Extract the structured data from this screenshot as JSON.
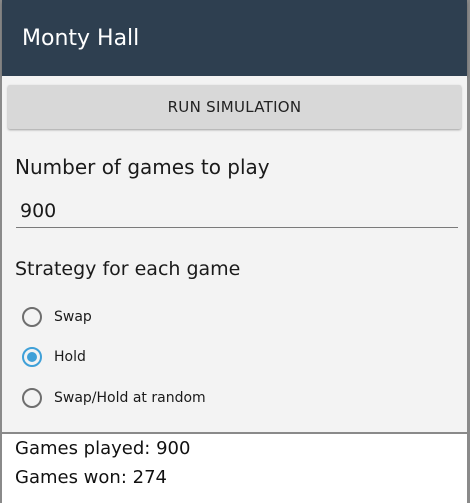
{
  "appbar": {
    "title": "Monty Hall",
    "background_color": "#2e3f50"
  },
  "run_button": {
    "label": "RUN SIMULATION"
  },
  "games_field": {
    "label": "Number of games to play",
    "value": "900"
  },
  "strategy": {
    "label": "Strategy for each game",
    "options": [
      {
        "label": "Swap",
        "checked": false
      },
      {
        "label": "Hold",
        "checked": true
      },
      {
        "label": "Swap/Hold at random",
        "checked": false
      }
    ],
    "accent_color": "#3fa0d8"
  },
  "results": {
    "played": "Games played: 900",
    "won": "Games won: 274"
  }
}
